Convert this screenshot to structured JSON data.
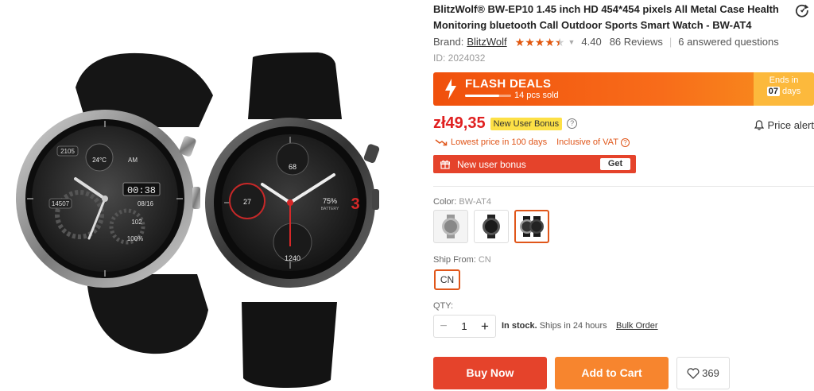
{
  "product": {
    "title": "BlitzWolf® BW-EP10 1.45 inch HD 454*454 pixels All Metal Case Health Monitoring bluetooth Call Outdoor Sports Smart Watch - BW-AT4",
    "brand_label": "Brand:",
    "brand_name": "BlitzWolf",
    "rating": "4.40",
    "rating_stars": 4.4,
    "reviews": "86 Reviews",
    "questions": "6 answered questions",
    "id_label": "ID: 2024032"
  },
  "watch_left": {
    "step_value": "2105",
    "temp": "24°C",
    "period": "AM",
    "time": "00:38",
    "steps2": "14507",
    "date": "08/16",
    "heart": "102",
    "battery": "100%"
  },
  "watch_right": {
    "heart": "68",
    "left_value": "27",
    "battery": "75%",
    "battery_label": "BATTERY",
    "bottom_value": "1240",
    "hour": "3"
  },
  "flash": {
    "title": "FLASH DEALS",
    "sold": "14 pcs sold",
    "progress": 0.74,
    "ends_label": "Ends in",
    "ends_days_value": "07",
    "ends_days_unit": "days"
  },
  "pricing": {
    "price": "zł49,35",
    "new_user_badge": "New User Bonus",
    "price_alert": "Price alert",
    "lowest": "Lowest price in 100 days",
    "vat": "Inclusive of VAT",
    "new_user_bar": "New user bonus",
    "get_label": "Get"
  },
  "options": {
    "color_label": "Color:",
    "color_value": "BW-AT4",
    "ship_label": "Ship From:",
    "ship_value": "CN",
    "ship_button": "CN"
  },
  "quantity": {
    "label": "QTY:",
    "minus": "−",
    "value": "1",
    "plus": "+",
    "in_stock": "In stock.",
    "ships": "Ships in 24 hours",
    "bulk": "Bulk Order"
  },
  "actions": {
    "buy": "Buy Now",
    "cart": "Add to Cart",
    "wishlist_count": "369"
  },
  "colors": {
    "accent": "#e0561a",
    "buy": "#e5432b",
    "cart": "#f7852e",
    "price": "#e02020"
  }
}
